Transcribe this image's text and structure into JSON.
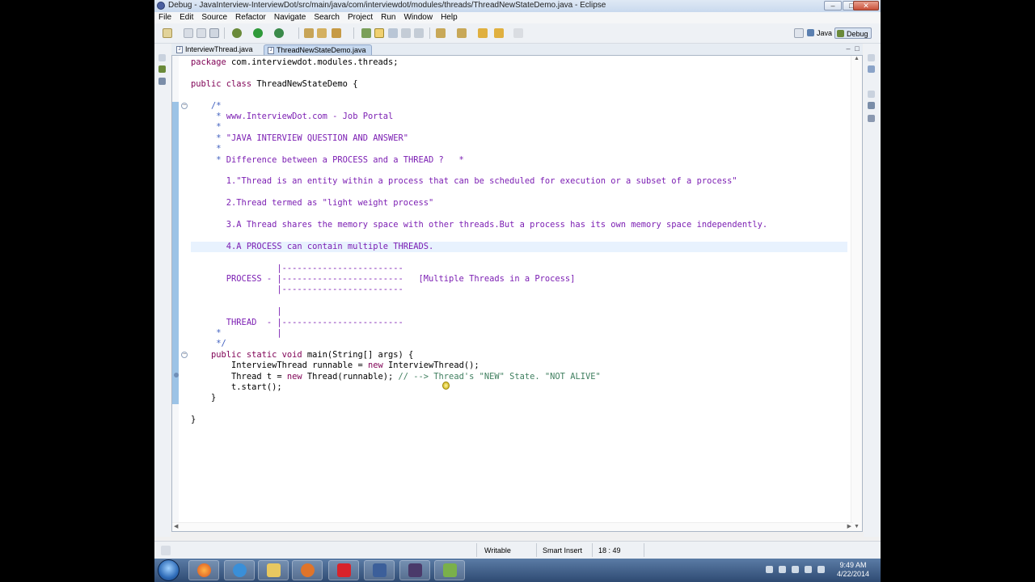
{
  "window": {
    "title": "Debug - JavaInterview-InterviewDot/src/main/java/com/interviewdot/modules/threads/ThreadNewStateDemo.java - Eclipse",
    "minimize": "–",
    "maximize": "□",
    "close": "✕"
  },
  "menu": [
    "File",
    "Edit",
    "Source",
    "Refactor",
    "Navigate",
    "Search",
    "Project",
    "Run",
    "Window",
    "Help"
  ],
  "perspectives": {
    "java": "Java",
    "debug": "Debug"
  },
  "tabs": [
    {
      "label": "InterviewThread.java",
      "active": false
    },
    {
      "label": "ThreadNewStateDemo.java",
      "active": true
    }
  ],
  "editor": {
    "lines": [
      [
        [
          "kw",
          "package"
        ],
        [
          "",
          " com.interviewdot.modules.threads;"
        ]
      ],
      [],
      [
        [
          "kw",
          "public class"
        ],
        [
          "",
          " ThreadNewStateDemo {"
        ]
      ],
      [],
      [
        [
          "",
          "    "
        ],
        [
          "cm",
          "/*"
        ]
      ],
      [
        [
          "cm",
          "     * "
        ],
        [
          "doc",
          "www.InterviewDot.com - Job Portal"
        ]
      ],
      [
        [
          "cm",
          "     *"
        ]
      ],
      [
        [
          "cm",
          "     * "
        ],
        [
          "doc",
          "\"JAVA INTERVIEW QUESTION AND ANSWER\""
        ]
      ],
      [
        [
          "cm",
          "     *"
        ]
      ],
      [
        [
          "cm",
          "     * "
        ],
        [
          "doc",
          "Difference between a PROCESS and a THREAD ?   *"
        ]
      ],
      [],
      [
        [
          "doc",
          "       1.\"Thread is an entity within a process that can be scheduled for execution or a subset of a process\""
        ]
      ],
      [],
      [
        [
          "doc",
          "       2.Thread termed as \"light weight process\""
        ]
      ],
      [],
      [
        [
          "doc",
          "       3.A Thread shares the memory space with other threads.But a process has its own memory space independently."
        ]
      ],
      [],
      [
        [
          "doc",
          "       4.A PROCESS can contain multiple THREADS."
        ]
      ],
      [],
      [
        [
          "doc",
          "                 |------------------------"
        ]
      ],
      [
        [
          "doc",
          "       PROCESS - |------------------------   [Multiple Threads in a Process]"
        ]
      ],
      [
        [
          "doc",
          "                 |------------------------"
        ]
      ],
      [],
      [
        [
          "doc",
          "                 |"
        ]
      ],
      [
        [
          "doc",
          "       THREAD  - |------------------------"
        ]
      ],
      [
        [
          "cm",
          "     *           "
        ],
        [
          "doc",
          "|"
        ]
      ],
      [
        [
          "cm",
          "     */"
        ]
      ],
      [
        [
          "",
          "    "
        ],
        [
          "kw",
          "public static void"
        ],
        [
          "",
          " main(String[] args) {"
        ]
      ],
      [
        [
          "",
          "        InterviewThread runnable = "
        ],
        [
          "kw",
          "new"
        ],
        [
          "",
          " InterviewThread();"
        ]
      ],
      [
        [
          "",
          "        Thread t = "
        ],
        [
          "kw",
          "new"
        ],
        [
          "",
          " Thread(runnable); "
        ],
        [
          "lc",
          "// --> Thread's \"NEW\" State. \"NOT ALIVE\""
        ]
      ],
      [
        [
          "",
          "        t.start();"
        ]
      ],
      [
        [
          "",
          "    }"
        ]
      ],
      [],
      [
        [
          "",
          "}"
        ]
      ]
    ]
  },
  "status": {
    "writable": "Writable",
    "insert_mode": "Smart Insert",
    "position": "18 : 49"
  },
  "clock": {
    "time": "9:49 AM",
    "date": "4/22/2014"
  }
}
